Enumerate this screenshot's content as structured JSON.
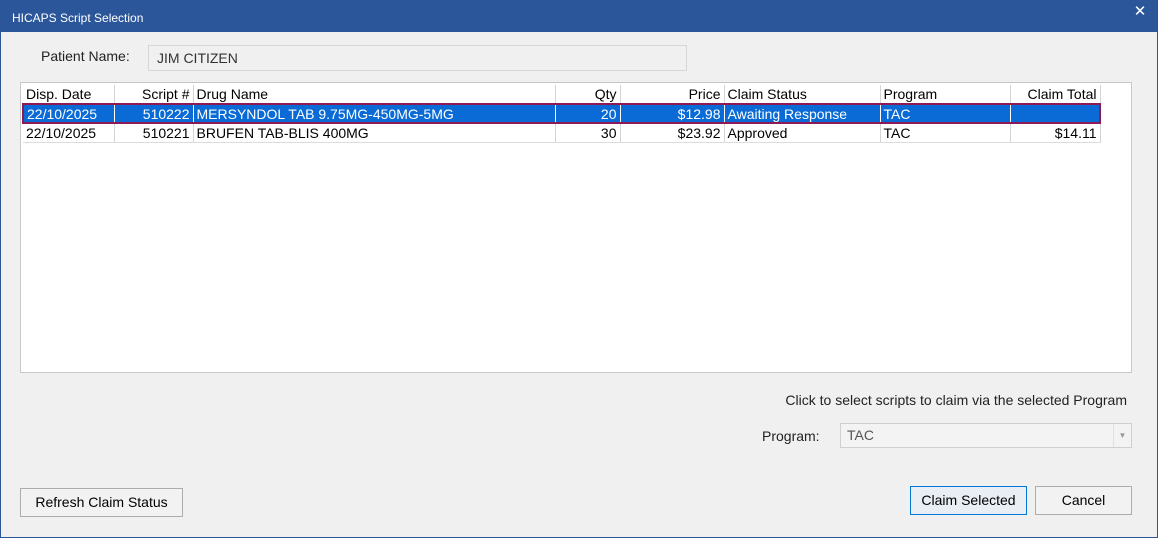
{
  "window": {
    "title": "HICAPS Script Selection",
    "close_glyph": "✕"
  },
  "patient": {
    "label": "Patient Name:",
    "value": "JIM CITIZEN"
  },
  "grid": {
    "columns": [
      "Disp. Date",
      "Script #",
      "Drug Name",
      "Qty",
      "Price",
      "Claim Status",
      "Program",
      "Claim Total"
    ],
    "rows": [
      {
        "date": "22/10/2025",
        "script": "510222",
        "drug": "MERSYNDOL TAB 9.75MG-450MG-5MG",
        "qty": "20",
        "price": "$12.98",
        "status": "Awaiting Response",
        "program": "TAC",
        "total": "",
        "selected": true
      },
      {
        "date": "22/10/2025",
        "script": "510221",
        "drug": "BRUFEN TAB-BLIS 400MG",
        "qty": "30",
        "price": "$23.92",
        "status": "Approved",
        "program": "TAC",
        "total": "$14.11",
        "selected": false
      }
    ]
  },
  "hint": "Click to select scripts to claim via the selected Program",
  "program": {
    "label": "Program:",
    "value": "TAC",
    "arrow_icon": "chevron-down-icon"
  },
  "buttons": {
    "refresh": "Refresh Claim Status",
    "claim": "Claim Selected",
    "cancel": "Cancel"
  },
  "colors": {
    "titlebar": "#2b579a",
    "selection": "#0a6bd6",
    "selection_border": "#8b1a55"
  }
}
